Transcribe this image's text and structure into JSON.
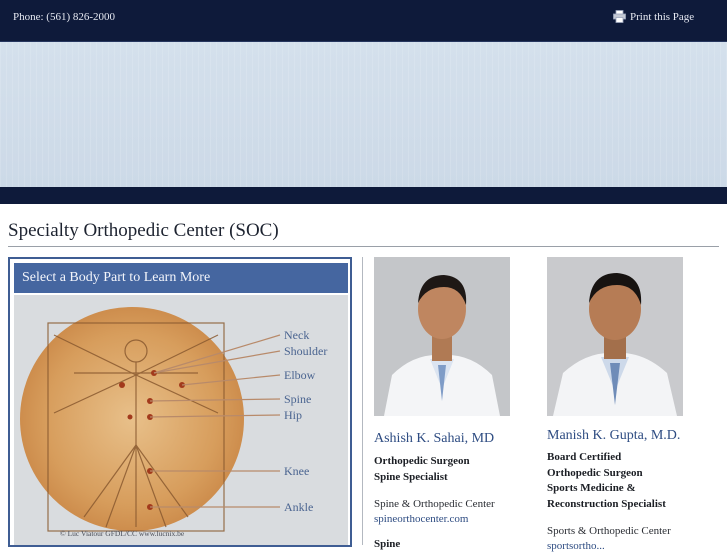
{
  "header": {
    "phone": "Phone: (561) 826-2000",
    "print_label": "Print this Page",
    "print_icon": "printer-icon"
  },
  "page": {
    "title": "Specialty Orthopedic Center (SOC)"
  },
  "body_panel": {
    "header": "Select a Body Part to Learn More",
    "parts": [
      "Neck",
      "Shoulder",
      "Elbow",
      "Spine",
      "Hip",
      "Knee",
      "Ankle"
    ],
    "credit": "© Luc Viatour GFDL/CC www.lucnix.be"
  },
  "doctors": [
    {
      "name": "Ashish K. Sahai, MD",
      "lines": [
        "Orthopedic Surgeon",
        "Spine Specialist"
      ],
      "center": "Spine & Orthopedic Center",
      "link": "spineorthocenter.com",
      "cut_line": "Spine"
    },
    {
      "name": "Manish K. Gupta, M.D.",
      "lines": [
        "Board Certified",
        "Orthopedic Surgeon",
        "Sports Medicine &",
        "Reconstruction Specialist"
      ],
      "center": "Sports & Orthopedic Center",
      "link": "sportsortho..."
    }
  ],
  "colors": {
    "topbar": "#0e1a3a",
    "banner": "#ccd9e7",
    "panel_header": "#4566a0",
    "link": "#2e4c82"
  }
}
